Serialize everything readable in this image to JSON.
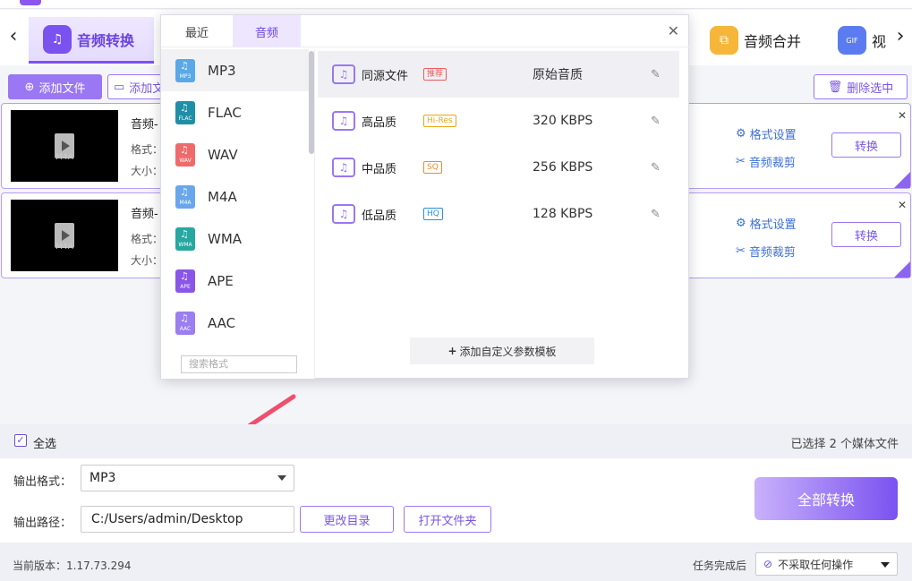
{
  "nav": {
    "tabs": [
      {
        "label": "音频转换",
        "icon": "headphones-icon"
      },
      {
        "label": "音频合并",
        "icon": "merge-icon"
      },
      {
        "label": "视",
        "icon": "gif-icon"
      }
    ]
  },
  "toolbar": {
    "add_file": "添加文件",
    "add_folder": "添加文",
    "delete_selected": "删除选中"
  },
  "files": [
    {
      "name": "音频-",
      "format_label": "格式：",
      "size_label": "大小：",
      "thumb_label": "M4A",
      "format_settings": "格式设置",
      "audio_trim": "音频裁剪",
      "convert": "转换"
    },
    {
      "name": "音频-",
      "format_label": "格式：",
      "size_label": "大小：",
      "thumb_label": "M4A",
      "format_settings": "格式设置",
      "audio_trim": "音频裁剪",
      "convert": "转换"
    }
  ],
  "popup": {
    "tabs": [
      "最近",
      "音频"
    ],
    "active_tab": "音频",
    "formats": [
      {
        "name": "MP3",
        "tag": "MP3",
        "color": "#5aa8e6"
      },
      {
        "name": "FLAC",
        "tag": "FLAC",
        "color": "#1f8fa8"
      },
      {
        "name": "WAV",
        "tag": "WAV",
        "color": "#ef6b6b"
      },
      {
        "name": "M4A",
        "tag": "M4A",
        "color": "#6aa6ec"
      },
      {
        "name": "WMA",
        "tag": "WMA",
        "color": "#26a7a0"
      },
      {
        "name": "APE",
        "tag": "APE",
        "color": "#8a56e8"
      },
      {
        "name": "AAC",
        "tag": "AAC",
        "color": "#9b7ef0"
      }
    ],
    "search_placeholder": "搜索格式",
    "qualities": [
      {
        "name": "同源文件",
        "badge": "推荐",
        "badge_color": "#ef5a5a",
        "rate": "原始音质"
      },
      {
        "name": "高品质",
        "badge": "Hi-Res",
        "badge_color": "#e6a818",
        "rate": "320 KBPS"
      },
      {
        "name": "中品质",
        "badge": "SQ",
        "badge_color": "#f08a2a",
        "rate": "256 KBPS"
      },
      {
        "name": "低品质",
        "badge": "HQ",
        "badge_color": "#2a8fe0",
        "rate": "128 KBPS"
      }
    ],
    "add_template": "添加自定义参数模板"
  },
  "selection": {
    "select_all": "全选",
    "selected_count": "已选择 2 个媒体文件"
  },
  "output": {
    "format_label": "输出格式：",
    "format_value": "MP3",
    "path_label": "输出路径：",
    "path_value": "C:/Users/admin/Desktop",
    "change_dir": "更改目录",
    "open_folder": "打开文件夹",
    "convert_all": "全部转换"
  },
  "status": {
    "version": "当前版本：1.17.73.294",
    "after_label": "任务完成后",
    "after_value": "不采取任何操作"
  },
  "colors": {
    "accent": "#7c52f5",
    "link": "#3d6fd8",
    "arrow": "#ef4f6d"
  }
}
